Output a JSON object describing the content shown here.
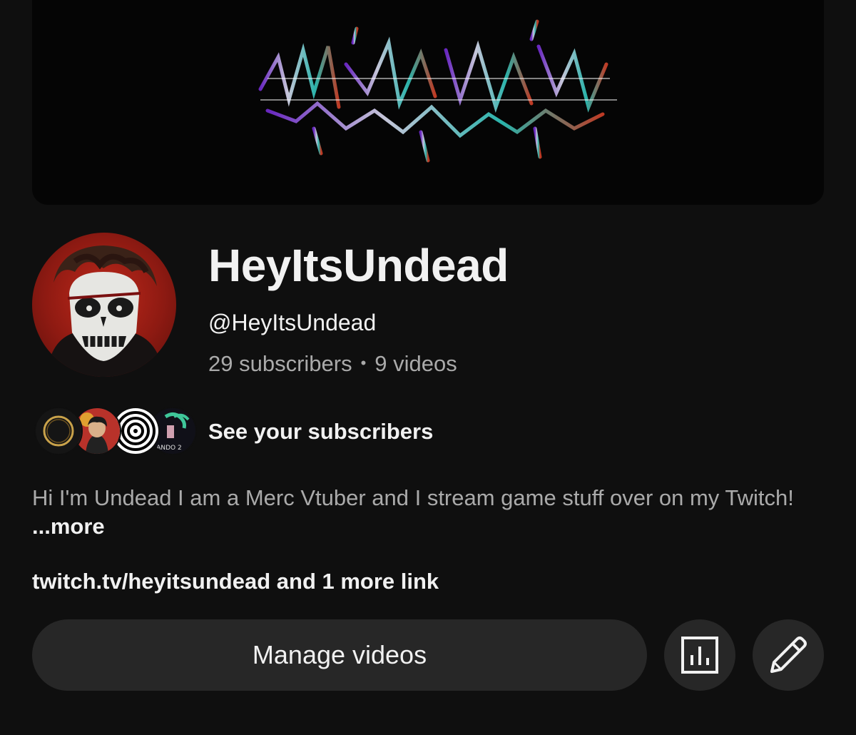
{
  "banner": {
    "icon": "glitch-logo-art"
  },
  "channel": {
    "name": "HeyItsUndead",
    "handle": "@HeyItsUndead",
    "subscribers": "29 subscribers",
    "separator": "•",
    "videos": "9 videos"
  },
  "subscribers_preview": {
    "label": "See your subscribers",
    "avatar_icons": [
      "golden-ring-avatar",
      "anime-character-avatar",
      "spiral-avatar",
      "orlando-avatar"
    ],
    "orlando_text": "LANDO 2"
  },
  "description": {
    "text": "Hi I'm Undead I am a Merc Vtuber  and I stream game stuff over on my Twitch! ",
    "more_label": "...more"
  },
  "links": {
    "text": "twitch.tv/heyitsundead and 1 more link"
  },
  "actions": {
    "manage_label": "Manage videos",
    "analytics_icon": "analytics-icon",
    "edit_icon": "pencil-icon"
  },
  "colors": {
    "background": "#0f0f0f",
    "button_bg": "#272727",
    "primary_text": "#f1f1f1",
    "secondary_text": "#aaaaaa",
    "avatar_red": "#c0291b"
  }
}
